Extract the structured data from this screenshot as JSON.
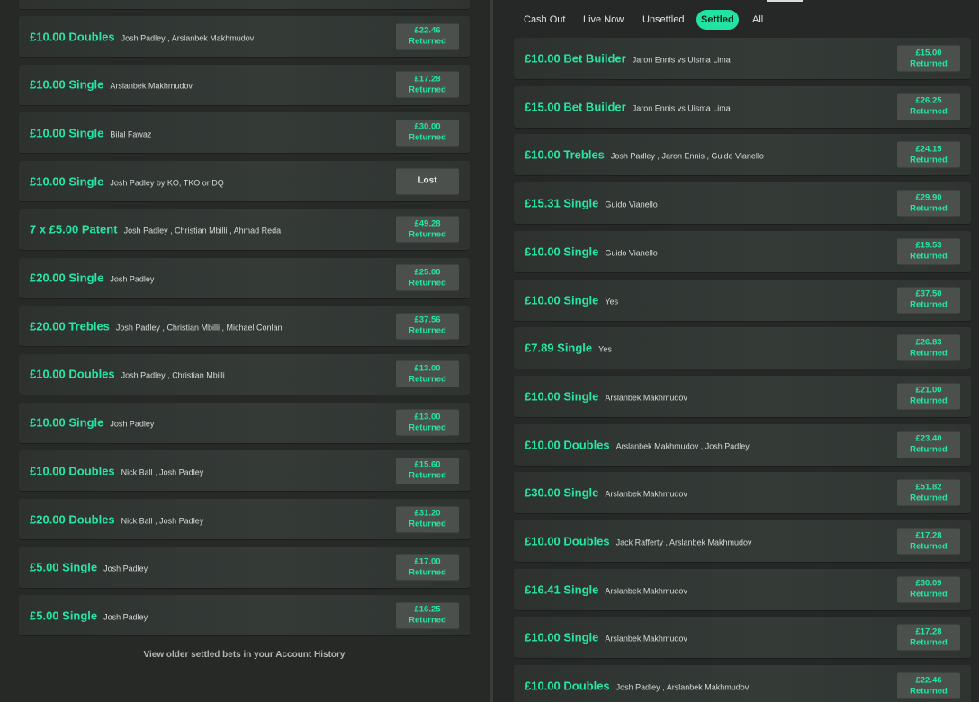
{
  "left_panel": {
    "bets": [
      {
        "stake": "£10.00 Doubles",
        "selection": "Josh Padley , Arslanbek Makhmudov",
        "amount": "£22.46",
        "status": "Returned"
      },
      {
        "stake": "£10.00 Single",
        "selection": "Arslanbek Makhmudov",
        "amount": "£17.28",
        "status": "Returned"
      },
      {
        "stake": "£10.00 Single",
        "selection": "Bilal Fawaz",
        "amount": "£30.00",
        "status": "Returned"
      },
      {
        "stake": "£10.00 Single",
        "selection": "Josh Padley by KO, TKO or DQ",
        "amount": "",
        "status": "Lost"
      },
      {
        "stake": "7 x £5.00 Patent",
        "selection": "Josh Padley , Christian Mbilli , Ahmad Reda",
        "amount": "£49.28",
        "status": "Returned"
      },
      {
        "stake": "£20.00 Single",
        "selection": "Josh Padley",
        "amount": "£25.00",
        "status": "Returned"
      },
      {
        "stake": "£20.00 Trebles",
        "selection": "Josh Padley , Christian Mbilli , Michael Conlan",
        "amount": "£37.56",
        "status": "Returned"
      },
      {
        "stake": "£10.00 Doubles",
        "selection": "Josh Padley , Christian Mbilli",
        "amount": "£13.00",
        "status": "Returned"
      },
      {
        "stake": "£10.00 Single",
        "selection": "Josh Padley",
        "amount": "£13.00",
        "status": "Returned"
      },
      {
        "stake": "£10.00 Doubles",
        "selection": "Nick Ball , Josh Padley",
        "amount": "£15.60",
        "status": "Returned"
      },
      {
        "stake": "£20.00 Doubles",
        "selection": "Nick Ball , Josh Padley",
        "amount": "£31.20",
        "status": "Returned"
      },
      {
        "stake": "£5.00 Single",
        "selection": "Josh Padley",
        "amount": "£17.00",
        "status": "Returned"
      },
      {
        "stake": "£5.00 Single",
        "selection": "Josh Padley",
        "amount": "£16.25",
        "status": "Returned"
      }
    ],
    "footer_link": "View older settled bets in your Account History"
  },
  "right_panel": {
    "tabs": [
      {
        "label": "Cash Out",
        "active": false
      },
      {
        "label": "Live Now",
        "active": false
      },
      {
        "label": "Unsettled",
        "active": false
      },
      {
        "label": "Settled",
        "active": true
      },
      {
        "label": "All",
        "active": false
      }
    ],
    "bets": [
      {
        "stake": "£10.00 Bet Builder",
        "selection": "Jaron Ennis vs Uisma Lima",
        "amount": "£15.00",
        "status": "Returned"
      },
      {
        "stake": "£15.00 Bet Builder",
        "selection": "Jaron Ennis vs Uisma Lima",
        "amount": "£26.25",
        "status": "Returned"
      },
      {
        "stake": "£10.00 Trebles",
        "selection": "Josh Padley , Jaron Ennis , Guido Vianello",
        "amount": "£24.15",
        "status": "Returned"
      },
      {
        "stake": "£15.31 Single",
        "selection": "Guido Vianello",
        "amount": "£29.90",
        "status": "Returned"
      },
      {
        "stake": "£10.00 Single",
        "selection": "Guido Vianello",
        "amount": "£19.53",
        "status": "Returned"
      },
      {
        "stake": "£10.00 Single",
        "selection": "Yes",
        "amount": "£37.50",
        "status": "Returned"
      },
      {
        "stake": "£7.89 Single",
        "selection": "Yes",
        "amount": "£26.83",
        "status": "Returned"
      },
      {
        "stake": "£10.00 Single",
        "selection": "Arslanbek Makhmudov",
        "amount": "£21.00",
        "status": "Returned"
      },
      {
        "stake": "£10.00 Doubles",
        "selection": "Arslanbek Makhmudov , Josh Padley",
        "amount": "£23.40",
        "status": "Returned"
      },
      {
        "stake": "£30.00 Single",
        "selection": "Arslanbek Makhmudov",
        "amount": "£51.82",
        "status": "Returned"
      },
      {
        "stake": "£10.00 Doubles",
        "selection": "Jack Rafferty , Arslanbek Makhmudov",
        "amount": "£17.28",
        "status": "Returned"
      },
      {
        "stake": "£16.41 Single",
        "selection": "Arslanbek Makhmudov",
        "amount": "£30.09",
        "status": "Returned"
      },
      {
        "stake": "£10.00 Single",
        "selection": "Arslanbek Makhmudov",
        "amount": "£17.28",
        "status": "Returned"
      },
      {
        "stake": "£10.00 Doubles",
        "selection": "Josh Padley , Arslanbek Makhmudov",
        "amount": "£22.46",
        "status": "Returned"
      }
    ]
  },
  "colors": {
    "accent": "#26e6a6",
    "background": "#242625",
    "card": "#343b37",
    "badge": "#4c504d"
  }
}
